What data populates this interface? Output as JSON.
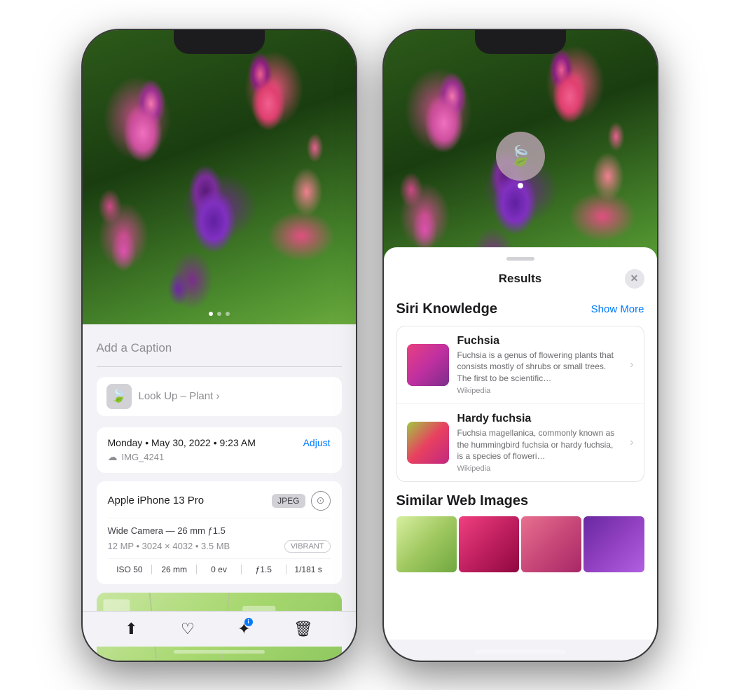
{
  "left_phone": {
    "caption_placeholder": "Add a Caption",
    "lookup_label": "Look Up –",
    "lookup_subject": "Plant",
    "meta_date": "Monday • May 30, 2022 • 9:23 AM",
    "meta_adjust": "Adjust",
    "meta_cloud_icon": "☁",
    "meta_filename": "IMG_4241",
    "device_name": "Apple iPhone 13 Pro",
    "badge_jpeg": "JPEG",
    "camera_spec": "Wide Camera — 26 mm ƒ1.5",
    "mp_info": "12 MP • 3024 × 4032 • 3.5 MB",
    "vibrant_label": "VIBRANT",
    "exif": [
      {
        "label": "ISO 50"
      },
      {
        "label": "26 mm"
      },
      {
        "label": "0 ev"
      },
      {
        "label": "ƒ1.5"
      },
      {
        "label": "1/181 s"
      }
    ],
    "toolbar_icons": [
      "share",
      "heart",
      "info",
      "trash"
    ]
  },
  "right_phone": {
    "results_title": "Results",
    "siri_knowledge_title": "Siri Knowledge",
    "show_more_label": "Show More",
    "close_label": "✕",
    "items": [
      {
        "name": "Fuchsia",
        "description": "Fuchsia is a genus of flowering plants that consists mostly of shrubs or small trees. The first to be scientific…",
        "source": "Wikipedia"
      },
      {
        "name": "Hardy fuchsia",
        "description": "Fuchsia magellanica, commonly known as the hummingbird fuchsia or hardy fuchsia, is a species of floweri…",
        "source": "Wikipedia"
      }
    ],
    "web_images_title": "Similar Web Images"
  }
}
